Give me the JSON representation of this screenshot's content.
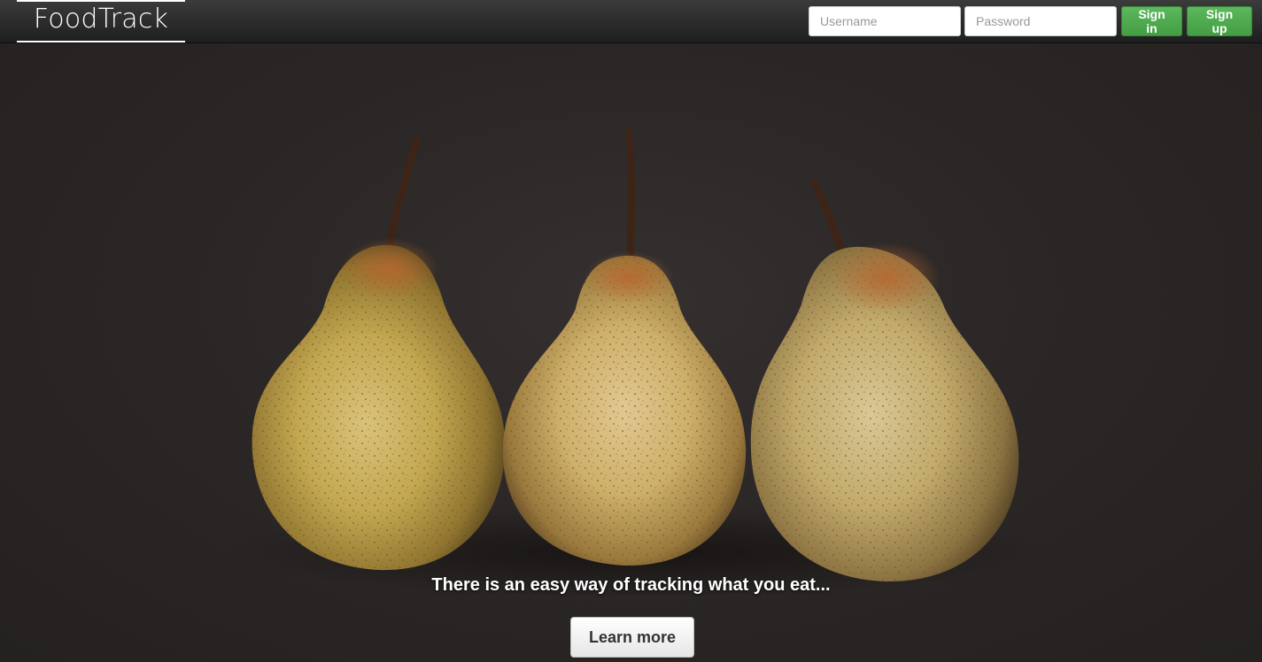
{
  "navbar": {
    "brand": "FoodTrack",
    "username_placeholder": "Username",
    "password_placeholder": "Password",
    "signin_label": "Sign in",
    "signup_label": "Sign up"
  },
  "hero": {
    "image": "three-pears-photo",
    "tagline": "There is an easy way of tracking what you eat...",
    "cta_label": "Learn more"
  },
  "colors": {
    "nav_background": "#2b2b2b",
    "button_green": "#5cb85c",
    "hero_background": "#2a2623"
  }
}
